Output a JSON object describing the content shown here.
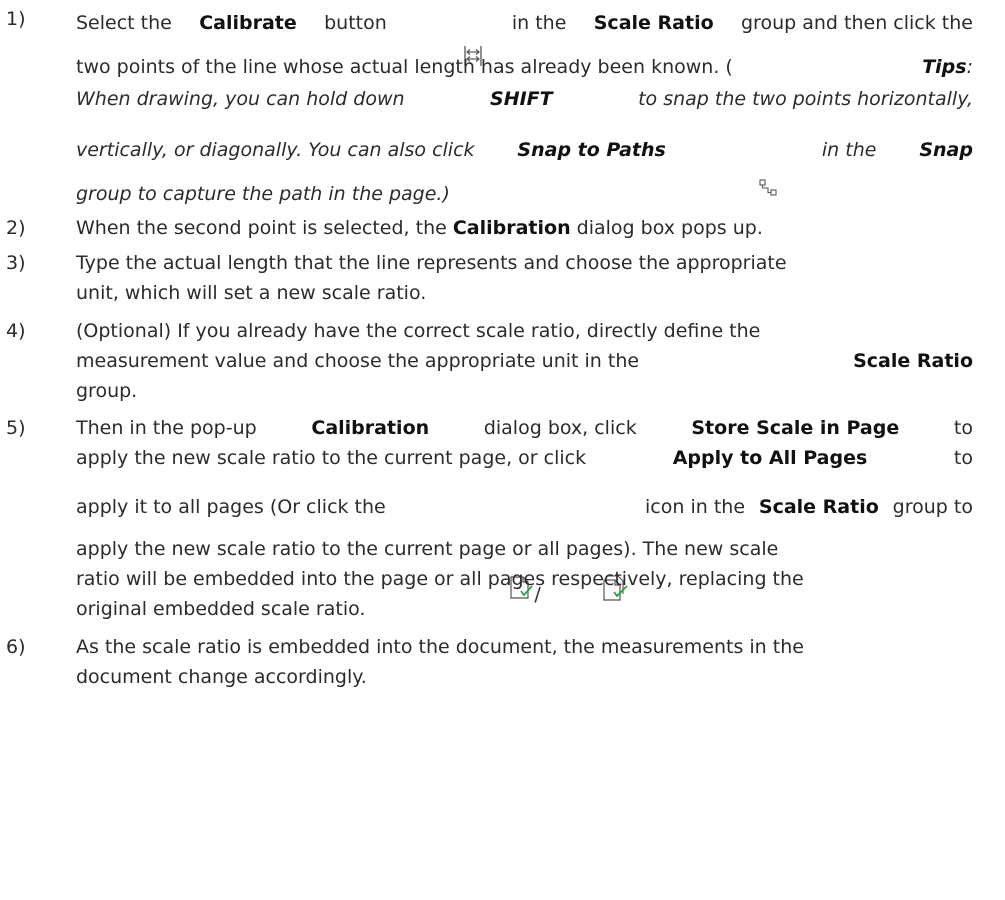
{
  "step1": {
    "num": "1)",
    "p1": "Select the",
    "calibrate": "Calibrate",
    "p2": "button",
    "p3": "in the",
    "scale_ratio": "Scale Ratio",
    "p4": "group and then click the",
    "line2": "two points of the line whose actual length has already been known. (",
    "tips": "Tips",
    "colon": ":",
    "line3a": "When drawing, you can hold down",
    "shift": "SHIFT",
    "line3b": "to snap the two points horizontally,",
    "line4a": "vertically, or diagonally. You can also click",
    "snap_to_paths": "Snap to Paths",
    "line4b": "in the",
    "snap": "Snap",
    "line5": "group to capture the path in the page.)"
  },
  "step2": {
    "num": "2)",
    "a": "When the second point is selected, the",
    "calibration": "Calibration",
    "b": "dialog box pops up."
  },
  "step3": {
    "num": "3)",
    "line1": "Type the actual length that the line represents and choose the appropriate",
    "line2": "unit, which will set a new scale ratio."
  },
  "step4": {
    "num": "4)",
    "line1": "(Optional) If you already have the correct scale ratio, directly define the",
    "line2a": "measurement value and choose the appropriate unit in the",
    "scale_ratio": "Scale Ratio",
    "line3": "group."
  },
  "step5": {
    "num": "5)",
    "a": "Then in the pop-up",
    "calibration": "Calibration",
    "b": "dialog box, click",
    "store": "Store Scale in Page",
    "c": "to",
    "d": "apply the new scale ratio to the current page, or click",
    "apply_all": "Apply to All Pages",
    "e": "to",
    "f": "apply it to all pages (Or click the",
    "slash": "/",
    "g": "icon in the",
    "scale_ratio": "Scale Ratio",
    "h": "group to",
    "line4": "apply the new scale ratio to the current page or all pages). The new scale",
    "line5": "ratio will be embedded into the page or all pages respectively, replacing the",
    "line6": "original embedded scale ratio."
  },
  "step6": {
    "num": "6)",
    "line1": "As the scale ratio is embedded into the document, the measurements in the",
    "line2": "document change accordingly."
  },
  "icons": {
    "calibrate": "calibrate-icon",
    "snap_to_paths": "snap-to-paths-icon",
    "store_scale": "store-scale-in-page-icon",
    "apply_all": "apply-to-all-pages-icon"
  },
  "colors": {
    "text": "#2b2b2b",
    "icon": "#555555",
    "check": "#2e9e4d"
  }
}
